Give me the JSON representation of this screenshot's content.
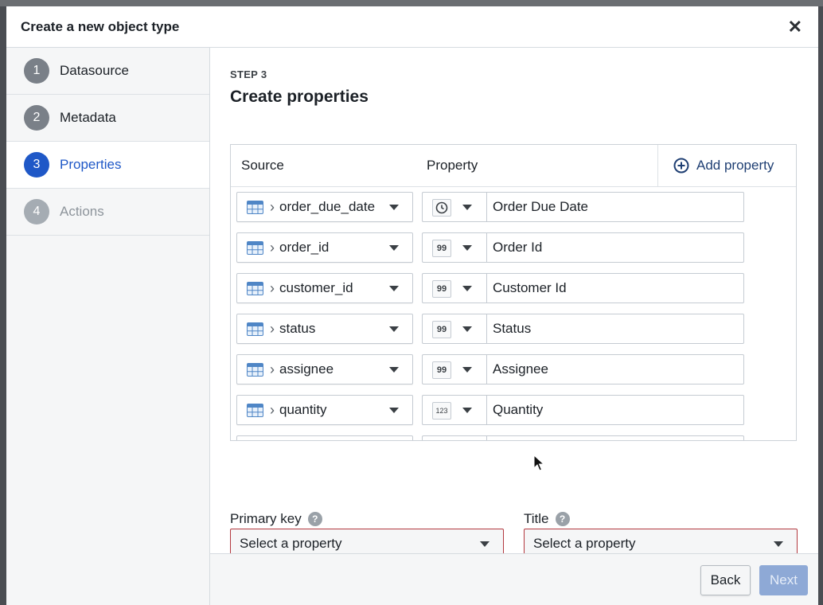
{
  "dialog": {
    "title": "Create a new object type"
  },
  "steps": [
    {
      "number": "1",
      "label": "Datasource",
      "state": "complete"
    },
    {
      "number": "2",
      "label": "Metadata",
      "state": "complete"
    },
    {
      "number": "3",
      "label": "Properties",
      "state": "active"
    },
    {
      "number": "4",
      "label": "Actions",
      "state": "disabled"
    }
  ],
  "main": {
    "step_caption": "STEP 3",
    "title": "Create properties"
  },
  "table": {
    "source_header": "Source",
    "property_header": "Property",
    "add_property_label": "Add property",
    "rows": [
      {
        "source": "order_due_date",
        "type_icon": "clock-icon",
        "type_glyph": "",
        "property_name": "Order Due Date"
      },
      {
        "source": "order_id",
        "type_icon": "quote-icon",
        "type_glyph": "99",
        "property_name": "Order Id"
      },
      {
        "source": "customer_id",
        "type_icon": "quote-icon",
        "type_glyph": "99",
        "property_name": "Customer Id"
      },
      {
        "source": "status",
        "type_icon": "quote-icon",
        "type_glyph": "99",
        "property_name": "Status"
      },
      {
        "source": "assignee",
        "type_icon": "quote-icon",
        "type_glyph": "99",
        "property_name": "Assignee"
      },
      {
        "source": "quantity",
        "type_icon": "number-icon",
        "type_glyph": "123",
        "property_name": "Quantity"
      }
    ]
  },
  "primary_key": {
    "label": "Primary key",
    "value": "Select a property"
  },
  "title_field": {
    "label": "Title",
    "value": "Select a property"
  },
  "footer": {
    "back_label": "Back",
    "next_label": "Next"
  },
  "colors": {
    "accent": "#1f58c7",
    "error_border": "#b3383f",
    "next_disabled": "#8ea9d6"
  }
}
